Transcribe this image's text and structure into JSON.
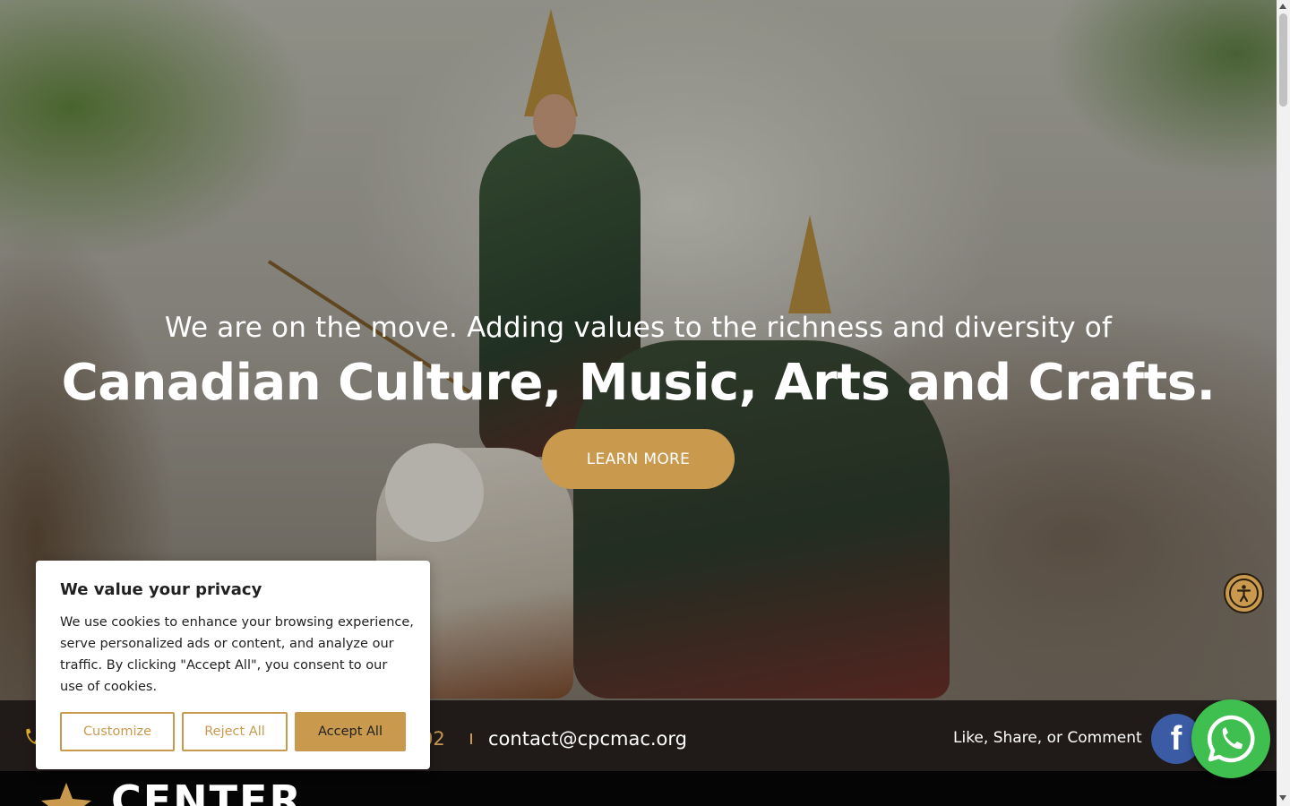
{
  "hero": {
    "subtitle": "We are on the move. Adding values to the richness and diversity of",
    "title": "Canadian Culture, Music, Arts and Crafts.",
    "cta_label": "LEARN MORE"
  },
  "contact_bar": {
    "phone_partial": "02",
    "email": "contact@cpcmac.org",
    "social_prompt": "Like, Share, or Comment",
    "facebook_glyph": "f"
  },
  "brand": {
    "name_partial": "CENTER"
  },
  "cookie_banner": {
    "title": "We value your privacy",
    "text": "We use cookies to enhance your browsing experience, serve personalized ads or content, and analyze our traffic. By clicking \"Accept All\", you consent to our use of cookies.",
    "customize_label": "Customize",
    "reject_label": "Reject All",
    "accept_label": "Accept All"
  },
  "icons": {
    "phone": "phone-icon",
    "accessibility": "accessibility-icon",
    "facebook": "facebook-icon",
    "whatsapp": "whatsapp-icon",
    "logo": "star-logo-icon"
  },
  "colors": {
    "accent_gold": "#c99a4e",
    "contact_bar_bg": "#201a19",
    "facebook_blue": "#3b5ba5",
    "whatsapp_green": "#3fbf4f"
  }
}
